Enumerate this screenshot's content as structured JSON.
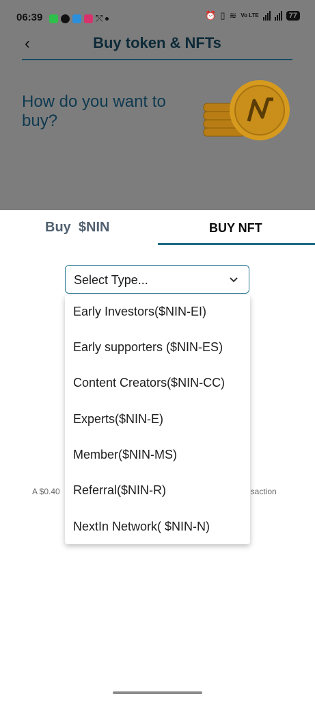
{
  "status_bar": {
    "time": "06:39",
    "battery": "77",
    "network": "Vo LTE"
  },
  "header": {
    "title": "Buy token & NFTs"
  },
  "hero": {
    "question": "How do you want to buy?"
  },
  "tabs": {
    "buy": "Buy  $NIN",
    "nft": "BUY NFT"
  },
  "select": {
    "placeholder": "Select Type..."
  },
  "dropdown": {
    "items": [
      "Early Investors($NIN-EI)",
      "Early supporters ($NIN-ES)",
      "Content Creators($NIN-CC)",
      "Experts($NIN-E)",
      "Member($NIN-MS)",
      "Referral($NIN-R)",
      "NextIn Network( $NIN-N)"
    ]
  },
  "behind_text": {
    "left": "A $0.40",
    "right": "nsaction"
  },
  "colors": {
    "accent": "#1f6a84",
    "title": "#0d2a38",
    "overlay": "#7d7d7d",
    "coin": "#e0a52a"
  }
}
